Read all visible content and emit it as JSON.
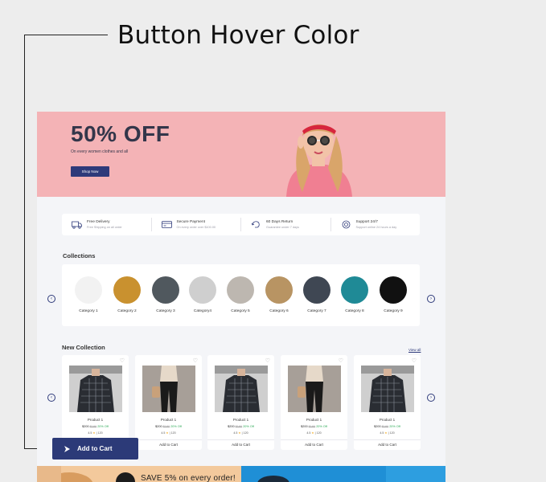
{
  "annotation": {
    "title": "Button Hover Color"
  },
  "hero": {
    "title": "50% OFF",
    "subtitle": "On every women clothes and all",
    "button": "Shop Now"
  },
  "features": [
    {
      "title": "Free Delivery",
      "subtitle": "Free Shipping on all order",
      "icon": "truck-icon"
    },
    {
      "title": "Secure Payment",
      "subtitle": "On every order over $100.00",
      "icon": "card-icon"
    },
    {
      "title": "60 Days Return",
      "subtitle": "Guarantee under 7 days",
      "icon": "return-icon"
    },
    {
      "title": "Support 24/7",
      "subtitle": "Support online 24 hours a day",
      "icon": "support-icon"
    }
  ],
  "collections": {
    "title": "Collections",
    "items": [
      {
        "label": "Category 1",
        "color": "#f2f2f2"
      },
      {
        "label": "Category 2",
        "color": "#c9912f"
      },
      {
        "label": "Category 3",
        "color": "#50585e"
      },
      {
        "label": "Category4",
        "color": "#cfcfcf"
      },
      {
        "label": "Category 5",
        "color": "#bdb7b0"
      },
      {
        "label": "Category 6",
        "color": "#b89463"
      },
      {
        "label": "Category 7",
        "color": "#3f4753"
      },
      {
        "label": "Category 8",
        "color": "#1f8a96"
      },
      {
        "label": "Category 9",
        "color": "#111111"
      }
    ]
  },
  "new_collection": {
    "title": "New Collection",
    "view_all": "View all",
    "products": [
      {
        "name": "Product 1",
        "price": "$200",
        "old_price": "$180",
        "discount": "20% Off",
        "rating": "4.5",
        "reviews": "| 120",
        "button": "Add to Cart",
        "img": "shirt"
      },
      {
        "name": "Product 1",
        "price": "$200",
        "old_price": "$180",
        "discount": "20% Off",
        "rating": "4.5",
        "reviews": "| 120",
        "button": "Add to Cart",
        "img": "pants"
      },
      {
        "name": "Product 1",
        "price": "$200",
        "old_price": "$180",
        "discount": "20% Off",
        "rating": "4.5",
        "reviews": "| 120",
        "button": "Add to Cart",
        "img": "shirt"
      },
      {
        "name": "Product 1",
        "price": "$200",
        "old_price": "$180",
        "discount": "20% Off",
        "rating": "4.5",
        "reviews": "| 120",
        "button": "Add to Cart",
        "img": "pants"
      },
      {
        "name": "Product 1",
        "price": "$200",
        "old_price": "$180",
        "discount": "20% Off",
        "rating": "4.5",
        "reviews": "| 120",
        "button": "Add to Cart",
        "img": "shirt"
      }
    ]
  },
  "promo": {
    "text": "SAVE 5% on every order!"
  },
  "hover_button": {
    "label": "Add to Cart",
    "color": "#2c3a78"
  },
  "colors": {
    "primary": "#2e3a7a",
    "hero_bg": "#f4b3b6",
    "page_bg": "#f4f5f8"
  }
}
